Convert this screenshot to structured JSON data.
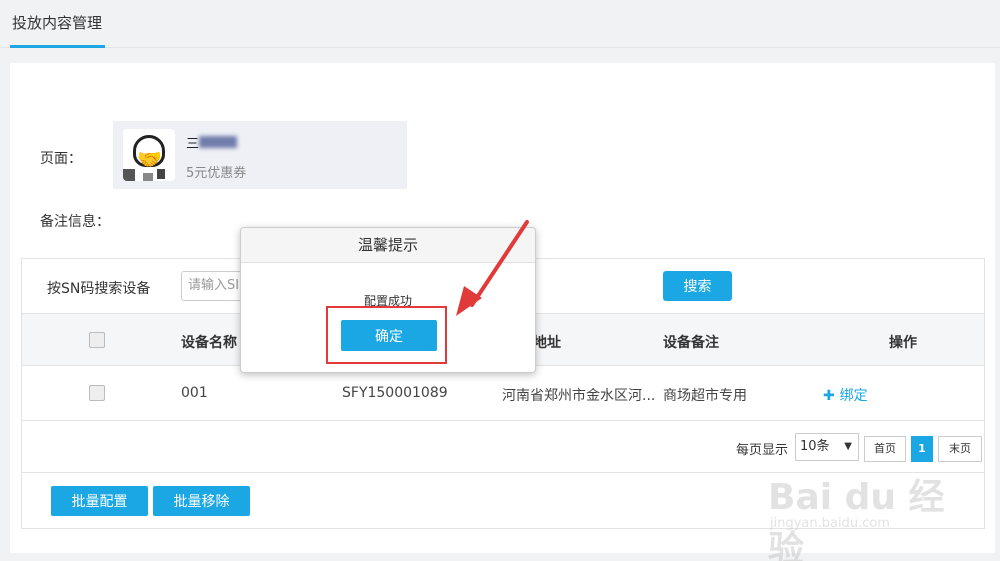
{
  "header": {
    "tab_title": "投放内容管理"
  },
  "form": {
    "page_label": "页面：",
    "page_card": {
      "name": "三",
      "subtitle": "5元优惠券"
    },
    "remark_label": "备注信息："
  },
  "search": {
    "label": "按SN码搜索设备",
    "input_value": "请输入SI",
    "button_label": "搜索"
  },
  "table": {
    "columns": [
      "设备名称",
      "地址",
      "设备备注",
      "操作"
    ],
    "rows": [
      {
        "name": "001",
        "sn": "SFY150001089",
        "address": "河南省郑州市金水区河...",
        "remark": "商场超市专用",
        "action": "绑定"
      }
    ]
  },
  "pagination": {
    "per_page_label": "每页显示",
    "per_page_value": "10条",
    "first_label": "首页",
    "current_page": "1",
    "last_label": "末页"
  },
  "batch": {
    "config_label": "批量配置",
    "remove_label": "批量移除"
  },
  "modal": {
    "title": "温馨提示",
    "message": "配置成功",
    "ok_label": "确定"
  },
  "watermark": {
    "logo": "Bai du 经验",
    "url": "jingyan.baidu.com"
  },
  "colors": {
    "accent": "#1aa7e4",
    "annotation_red": "#e23a3a"
  }
}
